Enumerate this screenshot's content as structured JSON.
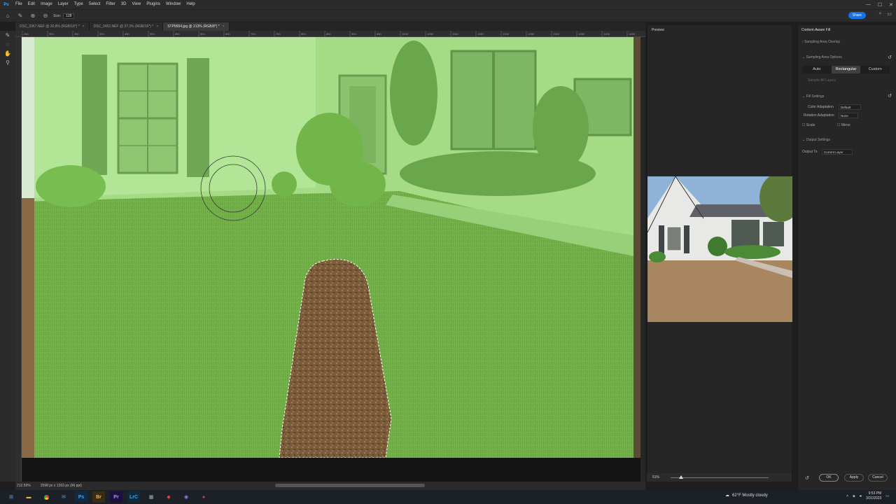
{
  "app": {
    "logo": "Ps"
  },
  "menu": [
    "File",
    "Edit",
    "Image",
    "Layer",
    "Type",
    "Select",
    "Filter",
    "3D",
    "View",
    "Plugins",
    "Window",
    "Help"
  ],
  "options": {
    "size_label": "Size:",
    "size_value": "128"
  },
  "share_label": "Share",
  "tabs": [
    {
      "label": "DSC_3367.NEF @ 20.8% (RGB/16*) *",
      "active": false
    },
    {
      "label": "DSC_3452.NEF @ 37.3% (RGB/16*) *",
      "active": false
    },
    {
      "label": "STP9654.jpg @ 213% (RGB/8*) *",
      "active": true
    }
  ],
  "ruler_ticks": [
    "250",
    "300",
    "350",
    "400",
    "450",
    "500",
    "550",
    "600",
    "650",
    "700",
    "750",
    "800",
    "850",
    "900",
    "950",
    "1000",
    "1050",
    "1100",
    "1150",
    "1200",
    "1250",
    "1300",
    "1350",
    "1400",
    "1450"
  ],
  "status": {
    "zoom": "212.59%",
    "doc": "2598 px x 1393 px (96 ppi)"
  },
  "preview": {
    "title": "Preview",
    "zoom": "51%"
  },
  "caf": {
    "title": "Content-Aware Fill",
    "sampling_overlay": "Sampling Area Overlay",
    "sampling_options": "Sampling Area Options",
    "modes": [
      "Auto",
      "Rectangular",
      "Custom"
    ],
    "selected_mode": "Rectangular",
    "sample_all": "Sample All Layers",
    "fill_settings": "Fill Settings",
    "color_adaptation_label": "Color Adaptation",
    "color_adaptation_value": "Default",
    "rotation_label": "Rotation Adaptation",
    "rotation_value": "None",
    "scale_label": "Scale",
    "mirror_label": "Mirror",
    "output_settings": "Output Settings",
    "output_to_label": "Output To",
    "output_to_value": "Current Layer",
    "ok": "OK",
    "apply": "Apply",
    "cancel": "Cancel"
  },
  "taskbar": {
    "weather": "62°F  Mostly cloudy",
    "time": "9:53 PM",
    "date": "3/31/2023"
  }
}
